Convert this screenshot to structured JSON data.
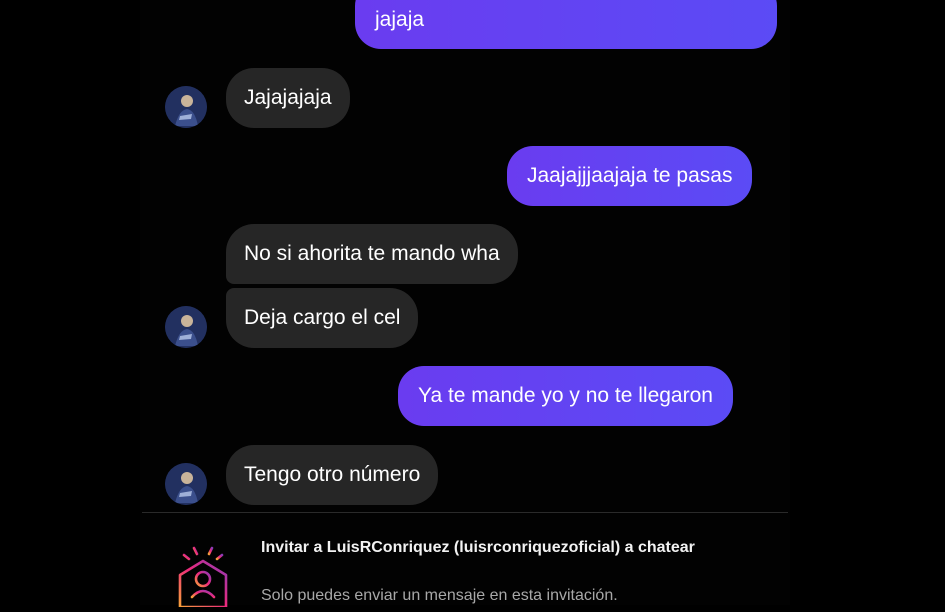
{
  "messages": [
    {
      "text": "jajaja",
      "from": "me"
    },
    {
      "text": "Jajajajaja",
      "from": "them"
    },
    {
      "text": "Jaajajjjaajaja te pasas",
      "from": "me"
    },
    {
      "text": "No si ahorita te mando wha",
      "from": "them"
    },
    {
      "text": "Deja cargo el cel",
      "from": "them"
    },
    {
      "text": "Ya te mande yo y no te llegaron",
      "from": "me"
    },
    {
      "text": "Tengo otro número",
      "from": "them"
    }
  ],
  "invite": {
    "title": "Invitar a LuisRConriquez (luisrconriquezoficial) a chatear",
    "subtitle": "Solo puedes enviar un mensaje en esta invitación."
  },
  "colors": {
    "sent_bubble": "#6a3cf0",
    "received_bubble": "#262626",
    "background": "#000000"
  },
  "icons": {
    "avatar": "profile-photo",
    "invite": "envelope-person-icon"
  }
}
